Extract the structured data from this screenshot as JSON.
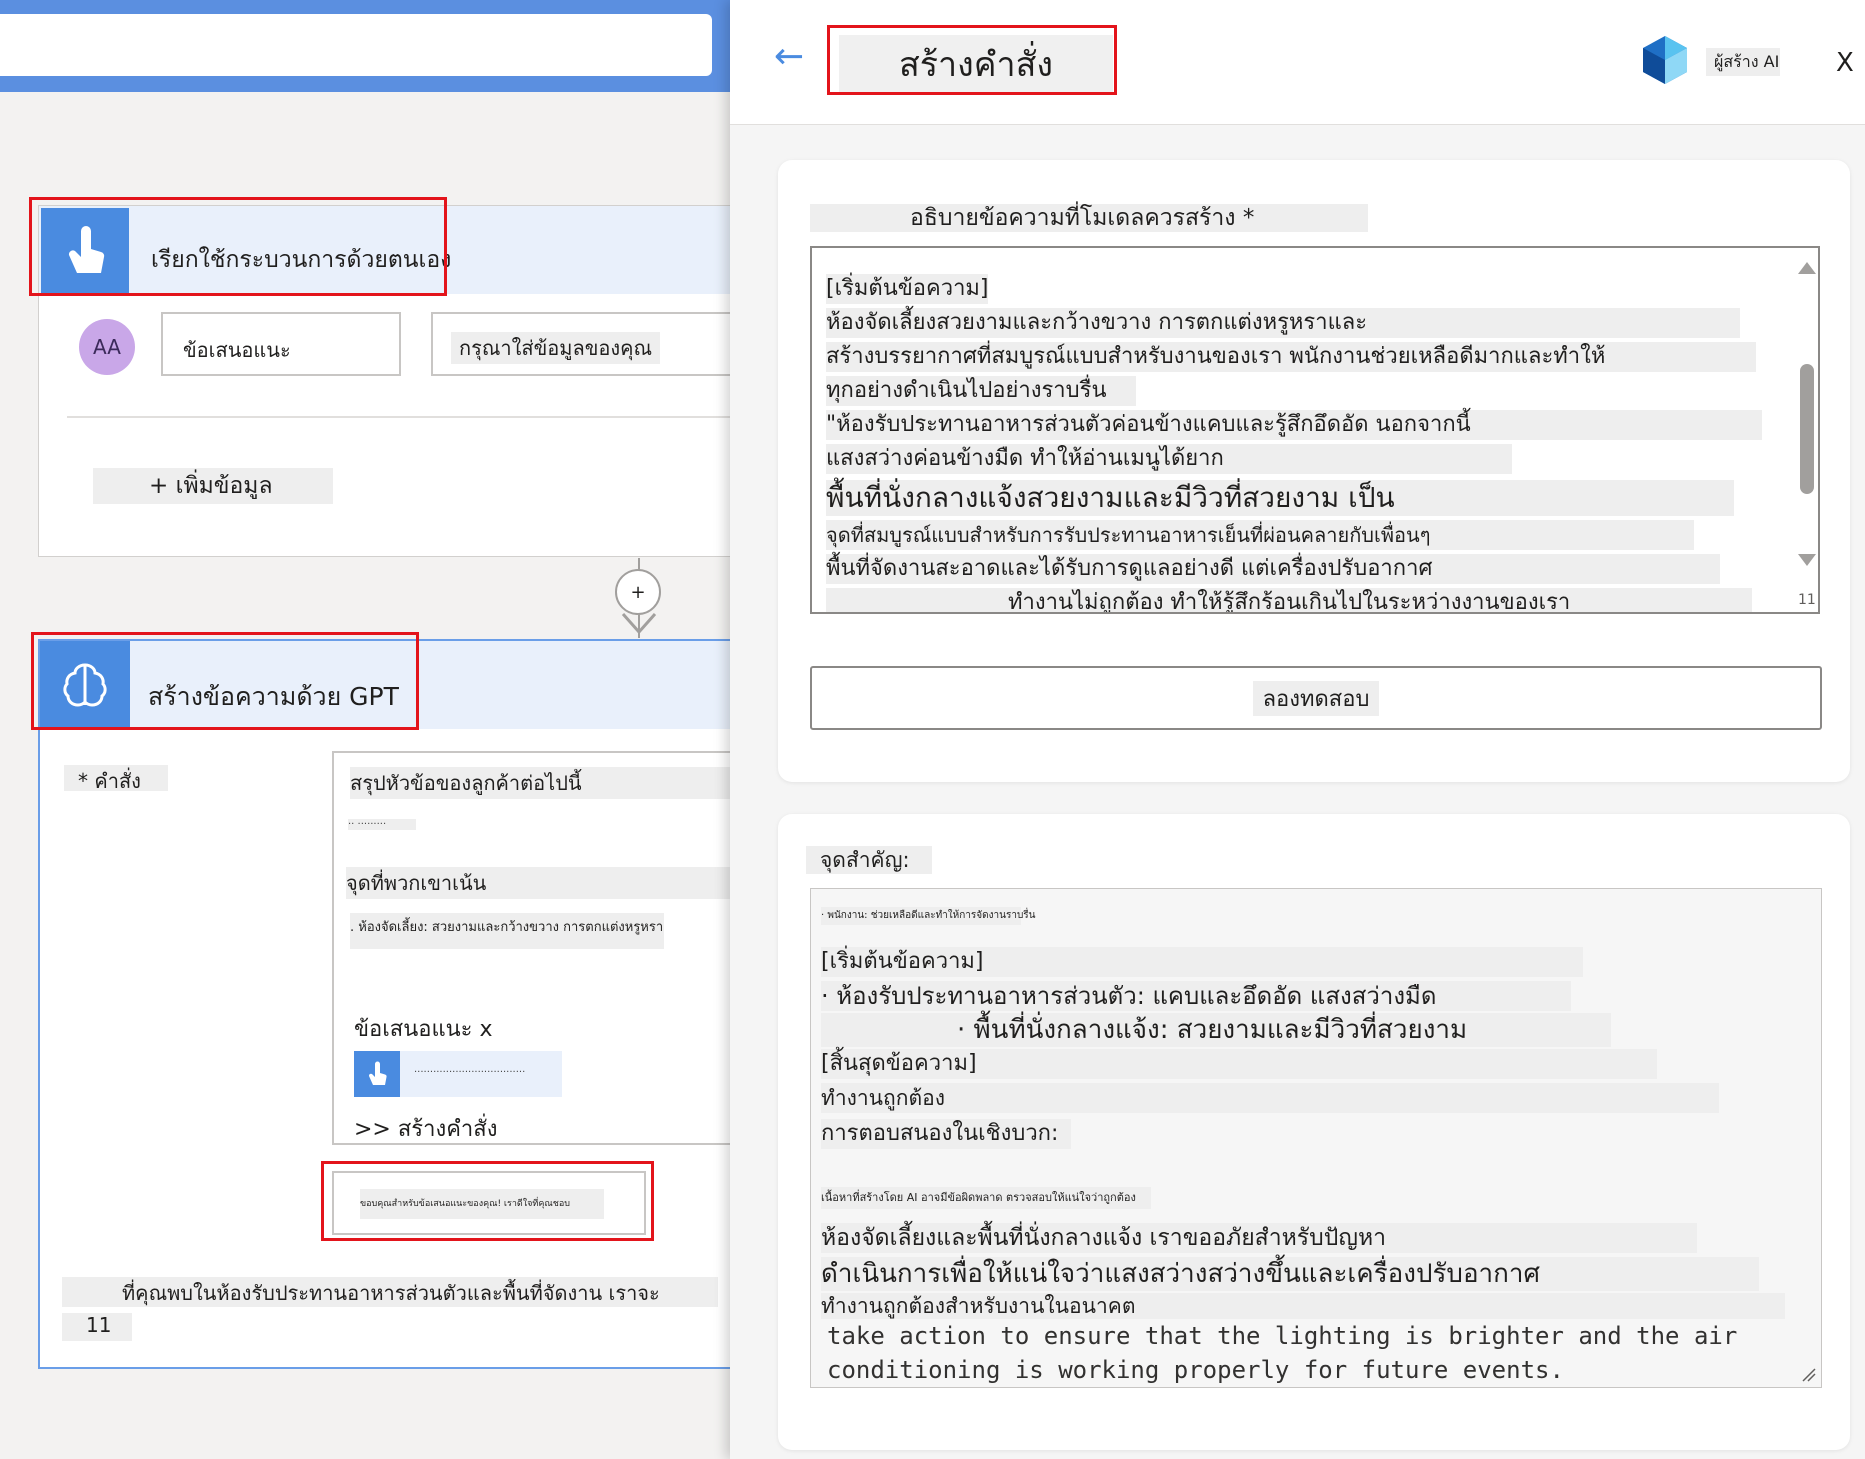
{
  "flow": {
    "trigger": {
      "title": "เรียกใช้กระบวนการด้วยตนเอง",
      "avatar": "AA",
      "field_label": "ข้อเสนอแนะ",
      "field_placeholder": "กรุณาใส่ข้อมูลของคุณ",
      "add_input": "+ เพิ่มข้อมูล"
    },
    "add_step": "+",
    "gpt": {
      "title": "สร้างข้อความด้วย GPT",
      "prompt_label": "* คำสั่ง",
      "prompt_lines": {
        "l1": "สรุปหัวข้อของลูกค้าต่อไปนี้",
        "l2": "·· ·········",
        "l3": "จุดที่พวกเขาเน้น",
        "l4": ". ห้องจัดเลี้ยง: สวยงามและกว้างขวาง การตกแต่งหรูหรา"
      },
      "feedback_token": "ข้อเสนอแนะ x",
      "token_text": "···································",
      "create_prompt": ">> สร้างคำสั่ง",
      "thanks": "ขอบคุณสำหรับข้อเสนอแนะของคุณ! เราดีใจที่คุณชอบ",
      "bottom_text": "ที่คุณพบในห้องรับประทานอาหารส่วนตัวและพื้นที่จัดงาน เราจะ",
      "bottom_number": "11"
    }
  },
  "panel": {
    "back": "←",
    "title": "สร้างคำสั่ง",
    "brand": "ผู้สร้าง AI",
    "close": "X",
    "describe_label": "อธิบายข้อความที่โมเดลควรสร้าง *",
    "describe_lines": {
      "l1": "[เริ่มต้นข้อความ]",
      "l2": "ห้องจัดเลี้ยงสวยงามและกว้างขวาง การตกแต่งหรูหราและ",
      "l3": "สร้างบรรยากาศที่สมบูรณ์แบบสำหรับงานของเรา พนักงานช่วยเหลือดีมากและทำให้",
      "l4": "ทุกอย่างดำเนินไปอย่างราบรื่น",
      "l5": "\"ห้องรับประทานอาหารส่วนตัวค่อนข้างแคบและรู้สึกอึดอัด นอกจากนี้",
      "l6": "แสงสว่างค่อนข้างมืด ทำให้อ่านเมนูได้ยาก",
      "l7": "พื้นที่นั่งกลางแจ้งสวยงามและมีวิวที่สวยงาม เป็น",
      "l8": "จุดที่สมบูรณ์แบบสำหรับการรับประทานอาหารเย็นที่ผ่อนคลายกับเพื่อนๆ",
      "l9": "พื้นที่จัดงานสะอาดและได้รับการดูแลอย่างดี แต่เครื่องปรับอากาศ",
      "l10": "ทำงานไม่ถูกต้อง ทำให้รู้สึกร้อนเกินไปในระหว่างงานของเรา"
    },
    "counter": "11",
    "test_button": "ลองทดสอบ",
    "result_label": "จุดสำคัญ:",
    "result_lines": {
      "l1": "· พนักงาน: ช่วยเหลือดีและทำให้การจัดงานราบรื่น",
      "l2": "[เริ่มต้นข้อความ]",
      "l3": "· ห้องรับประทานอาหารส่วนตัว: แคบและอึดอัด แสงสว่างมืด",
      "l4": "· พื้นที่นั่งกลางแจ้ง: สวยงามและมีวิวที่สวยงาม",
      "l5": "[สิ้นสุดข้อความ]",
      "l6": "ทำงานถูกต้อง",
      "l7": "การตอบสนองในเชิงบวก:",
      "l8": "เนื้อหาที่สร้างโดย AI อาจมีข้อผิดพลาด ตรวจสอบให้แน่ใจว่าถูกต้อง",
      "l9": "ห้องจัดเลี้ยงและพื้นที่นั่งกลางแจ้ง เราขออภัยสำหรับปัญหา",
      "l10": "ดำเนินการเพื่อให้แน่ใจว่าแสงสว่างสว่างขึ้นและเครื่องปรับอากาศ",
      "l11": "ทำงานถูกต้องสำหรับงานในอนาคต",
      "en1": "take action to ensure that the lighting is brighter and the air",
      "en2": "conditioning is working properly for future events."
    }
  },
  "colors": {
    "accent": "#4a8be0",
    "highlight": "#e3141b"
  }
}
